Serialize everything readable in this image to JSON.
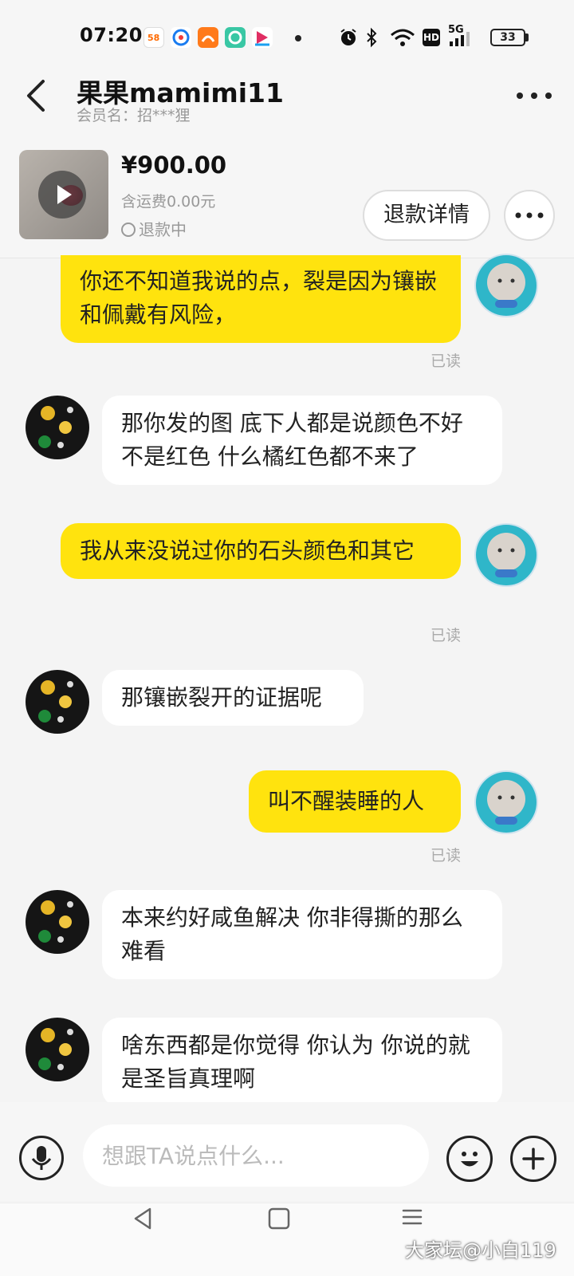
{
  "status_bar": {
    "time": "07:20",
    "app_icons": [
      "58-app-icon",
      "browser-icon",
      "uc-browser-icon",
      "camera-app-icon",
      "video-app-icon"
    ],
    "hd_label": "HD",
    "network_label": "5G",
    "battery": "33"
  },
  "header": {
    "title": "果果mamimi11",
    "subtitle": "会员名：招***狸"
  },
  "product": {
    "price": "¥900.00",
    "shipping": "含运费0.00元",
    "status": "退款中",
    "refund_button": "退款详情"
  },
  "messages": [
    {
      "side": "mine",
      "text": "你还不知道我说的点，裂是因为镶嵌和佩戴有风险，",
      "read": "已读"
    },
    {
      "side": "theirs",
      "text": "那你发的图 底下人都是说颜色不好 不是红色 什么橘红色都不来了"
    },
    {
      "side": "mine",
      "text": "我从来没说过你的石头颜色和其它",
      "read": "已读"
    },
    {
      "side": "theirs",
      "text": "那镶嵌裂开的证据呢"
    },
    {
      "side": "mine",
      "text": "叫不醒装睡的人",
      "read": "已读"
    },
    {
      "side": "theirs",
      "text": "本来约好咸鱼解决 你非得撕的那么难看"
    },
    {
      "side": "theirs",
      "text": "啥东西都是你觉得 你认为 你说的就是圣旨真理啊"
    }
  ],
  "input": {
    "placeholder": "想跟TA说点什么..."
  },
  "watermark": "大家坛@小白119",
  "colors": {
    "my_bubble": "#ffe30e",
    "their_bubble": "#ffffff",
    "background": "#f4f4f4"
  }
}
